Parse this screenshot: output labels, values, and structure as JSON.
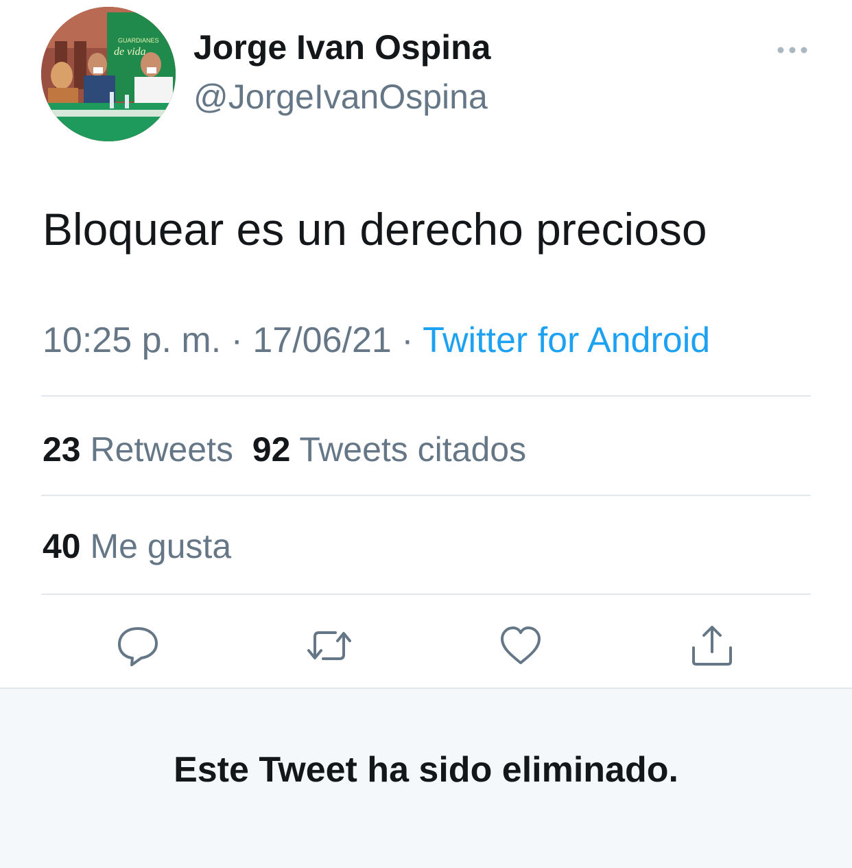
{
  "tweet": {
    "author": {
      "name": "Jorge Ivan Ospina",
      "handle": "@JorgeIvanOspina",
      "avatar_banner_text": [
        "GUARDIANES",
        "de vida"
      ]
    },
    "text": "Bloquear es un derecho precioso",
    "time": "10:25 p. m.",
    "separator": "·",
    "date": "17/06/21",
    "source": "Twitter for Android",
    "stats": {
      "retweets_count": "23",
      "retweets_label": "Retweets",
      "quotes_count": "92",
      "quotes_label": "Tweets citados",
      "likes_count": "40",
      "likes_label": "Me gusta"
    },
    "actions": {
      "icons": [
        "reply-icon",
        "retweet-icon",
        "like-icon",
        "share-icon"
      ]
    },
    "colors": {
      "link": "#1da1f2",
      "secondary_text": "#657786",
      "primary_text": "#14171a",
      "divider": "#e1e8ed",
      "panel_bg": "#f5f8fa"
    }
  },
  "deleted_notice": {
    "text": "Este Tweet ha sido eliminado."
  }
}
